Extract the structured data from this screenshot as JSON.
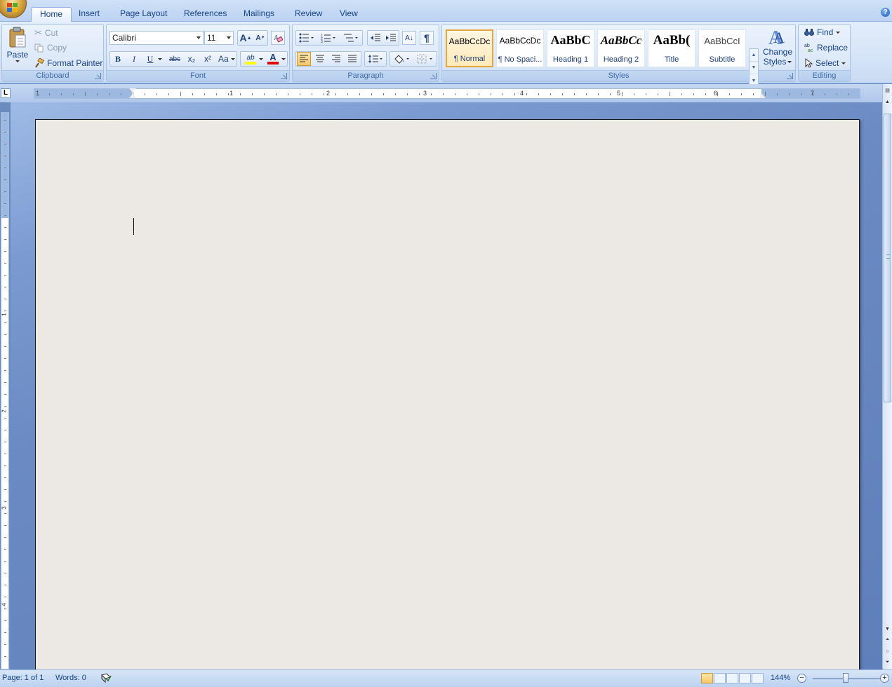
{
  "tabs": [
    "Home",
    "Insert",
    "Page Layout",
    "References",
    "Mailings",
    "Review",
    "View"
  ],
  "help_symbol": "?",
  "clipboard": {
    "group_label": "Clipboard",
    "paste_label": "Paste",
    "cut_label": "Cut",
    "copy_label": "Copy",
    "format_painter_label": "Format Painter"
  },
  "font": {
    "group_label": "Font",
    "font_name": "Calibri",
    "font_size": "11",
    "bold": "B",
    "italic": "I",
    "underline": "U",
    "strikethrough": "abc",
    "subscript": "x₂",
    "superscript": "x²",
    "change_case": "Aa",
    "grow": "A",
    "shrink": "A",
    "highlight": "ab",
    "font_color": "A",
    "highlight_color": "#ffff00",
    "font_color_value": "#e00000"
  },
  "paragraph": {
    "group_label": "Paragraph",
    "show_marks": "¶",
    "sort": "A↓"
  },
  "styles": {
    "group_label": "Styles",
    "tiles": [
      {
        "sample": "AaBbCcDc",
        "name": "¶ Normal"
      },
      {
        "sample": "AaBbCcDc",
        "name": "¶ No Spaci..."
      },
      {
        "sample": "AaBbC",
        "name": "Heading 1"
      },
      {
        "sample": "AaBbCc",
        "name": "Heading 2"
      },
      {
        "sample": "AaBb(",
        "name": "Title"
      },
      {
        "sample": "AaBbCcI",
        "name": "Subtitle"
      }
    ],
    "change_styles_line1": "Change",
    "change_styles_line2": "Styles"
  },
  "editing": {
    "group_label": "Editing",
    "find_label": "Find",
    "replace_label": "Replace",
    "select_label": "Select"
  },
  "ruler": {
    "tab_selector": "L",
    "numbers": [
      "1",
      "1",
      "2",
      "3",
      "4",
      "5",
      "6",
      "7"
    ],
    "vnumbers": [
      "1",
      "2",
      "3",
      "4"
    ]
  },
  "status": {
    "page": "Page: 1 of 1",
    "words": "Words: 0",
    "zoom": "144%"
  }
}
